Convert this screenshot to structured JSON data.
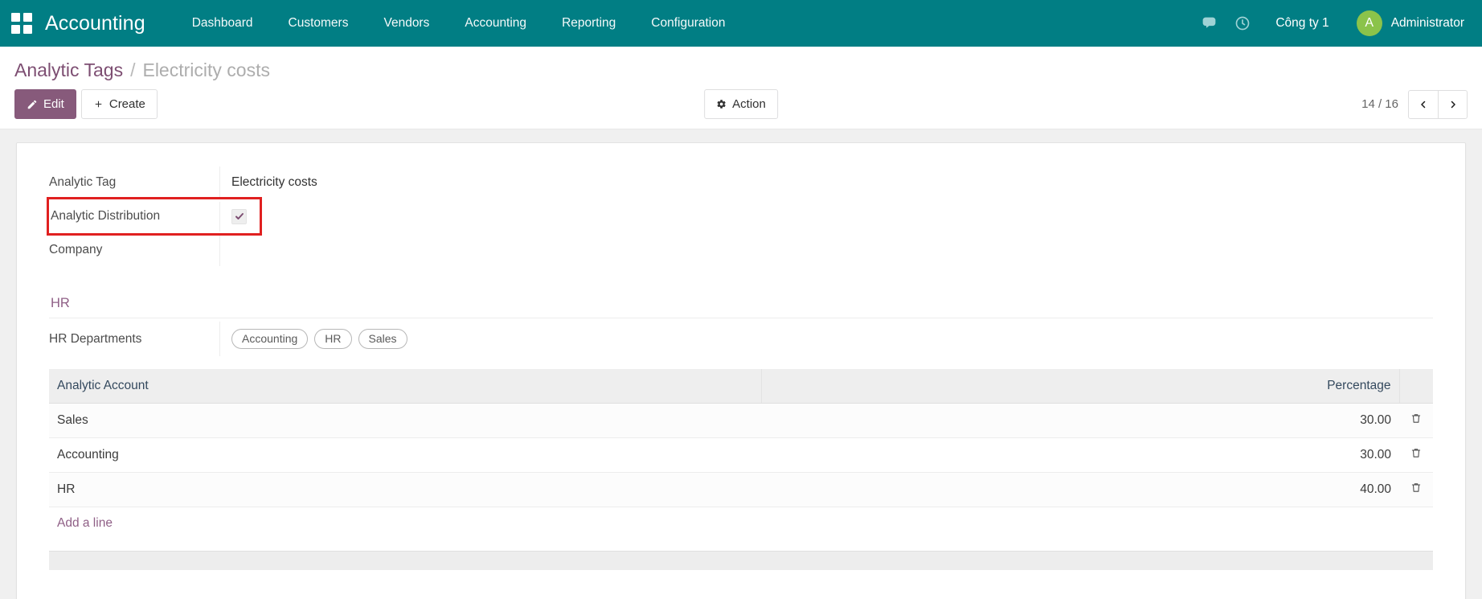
{
  "navbar": {
    "apps_icon": "apps-grid-icon",
    "brand": "Accounting",
    "menu": [
      {
        "label": "Dashboard"
      },
      {
        "label": "Customers"
      },
      {
        "label": "Vendors"
      },
      {
        "label": "Accounting"
      },
      {
        "label": "Reporting"
      },
      {
        "label": "Configuration"
      }
    ],
    "messages_icon": "chat-bubble-icon",
    "activities_icon": "clock-icon",
    "company": "Công ty 1",
    "avatar_initial": "A",
    "user": "Administrator",
    "colors": {
      "background": "#017e84",
      "avatar": "#8bc34a"
    }
  },
  "control_panel": {
    "breadcrumb": {
      "parent": "Analytic Tags",
      "separator": "/",
      "current": "Electricity costs"
    },
    "edit_label": "Edit",
    "create_label": "Create",
    "action_label": "Action",
    "pager": {
      "count": "14 / 16",
      "previous_icon": "chevron-left-icon",
      "next_icon": "chevron-right-icon"
    },
    "colors": {
      "primary": "#875a7b",
      "breadcrumb_link": "#7d4e72"
    }
  },
  "form": {
    "fields": [
      {
        "label": "Analytic Tag",
        "value": "Electricity costs"
      },
      {
        "label": "Analytic Distribution",
        "value": "",
        "checked": true,
        "highlighted": true
      },
      {
        "label": "Company",
        "value": ""
      }
    ],
    "analytic_tag": {
      "label": "Analytic Tag",
      "value": "Electricity costs"
    },
    "analytic_distribution": {
      "label": "Analytic Distribution"
    },
    "company": {
      "label": "Company",
      "value": ""
    },
    "section": {
      "title": "HR",
      "departments_label": "HR Departments",
      "departments": [
        "Accounting",
        "HR",
        "Sales"
      ]
    },
    "lines_table": {
      "columns": {
        "account": "Analytic Account",
        "percentage": "Percentage"
      },
      "rows": [
        {
          "account": "Sales",
          "percentage": "30.00",
          "delete_icon": "trash-icon"
        },
        {
          "account": "Accounting",
          "percentage": "30.00",
          "delete_icon": "trash-icon"
        },
        {
          "account": "HR",
          "percentage": "40.00",
          "delete_icon": "trash-icon"
        }
      ],
      "add_line_label": "Add a line"
    },
    "highlight_color": "#e02020"
  }
}
